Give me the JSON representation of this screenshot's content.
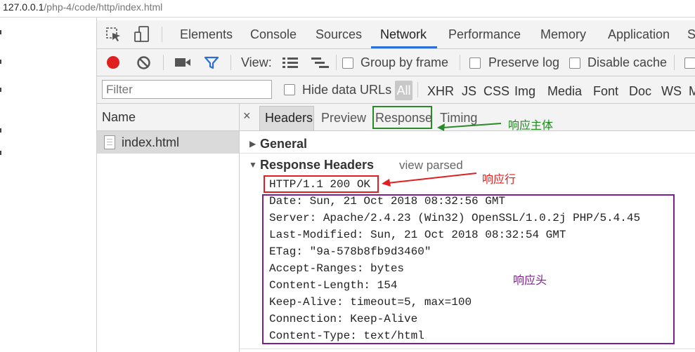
{
  "address": {
    "host": "127.0.0.1",
    "path": "/php-4/code/http/index.html"
  },
  "devtools": {
    "tabs": [
      "Elements",
      "Console",
      "Sources",
      "Network",
      "Performance",
      "Memory",
      "Application",
      "S"
    ],
    "active_tab": "Network"
  },
  "toolbar": {
    "view_label": "View:",
    "group_by_frame": "Group by frame",
    "preserve_log": "Preserve log",
    "disable_cache": "Disable cache"
  },
  "filter": {
    "placeholder": "Filter",
    "hide_data_urls": "Hide data URLs",
    "types": [
      "All",
      "XHR",
      "JS",
      "CSS",
      "Img",
      "Media",
      "Font",
      "Doc",
      "WS",
      "M"
    ]
  },
  "requests": {
    "header": "Name",
    "rows": [
      "index.html"
    ]
  },
  "detail": {
    "close": "×",
    "tabs": [
      "Headers",
      "Preview",
      "Response",
      "Timing"
    ],
    "active_tab": "Headers",
    "general_label": "General",
    "response_headers_label": "Response Headers",
    "view_parsed": "view parsed",
    "status_line": "HTTP/1.1 200 OK",
    "headers": [
      "Date: Sun, 21 Oct 2018 08:32:56 GMT",
      "Server: Apache/2.4.23 (Win32) OpenSSL/1.0.2j PHP/5.4.45",
      "Last-Modified: Sun, 21 Oct 2018 08:32:54 GMT",
      "ETag: \"9a-578b8fb9d3460\"",
      "Accept-Ranges: bytes",
      "Content-Length: 154",
      "Keep-Alive: timeout=5, max=100",
      "Connection: Keep-Alive",
      "Content-Type: text/html"
    ]
  },
  "annotations": {
    "response_body": "响应主体",
    "response_line": "响应行",
    "response_headers": "响应头"
  },
  "colors": {
    "record": "#e0201e",
    "filter_icon": "#2b6fd6",
    "tab_underline": "#2b6fd6",
    "box_green": "#2a8a2a",
    "box_red": "#e02020",
    "box_purple": "#7f1f8f"
  },
  "icons": {
    "select_element": "cursor-select-icon",
    "device_toolbar": "device-toggle-icon",
    "record": "record-icon",
    "clear": "clear-icon",
    "capture_screenshots": "camera-icon",
    "filter": "filter-funnel-icon",
    "large_rows": "list-view-icon",
    "overview": "waterfall-view-icon"
  }
}
